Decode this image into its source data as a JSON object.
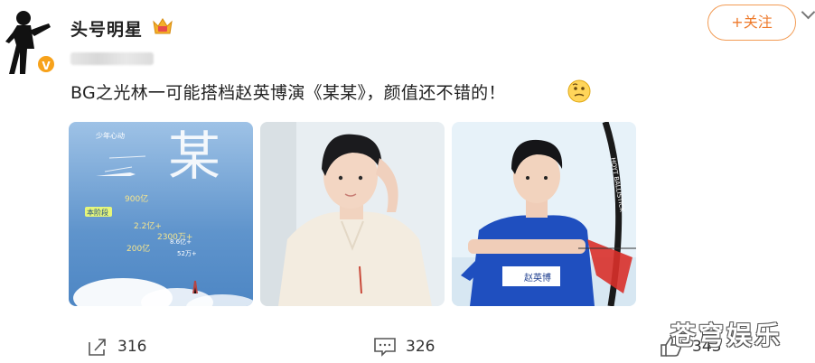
{
  "post": {
    "username": "头号明星",
    "text": "BG之光林一可能搭档赵英博演《某某》，颜值还不错的！",
    "follow_label": "+关注",
    "verified_mark": "V"
  },
  "images": [
    {
      "title_glyphs": "某",
      "poster_lines": [
        "少年心动",
        "900亿",
        "本阶段",
        "2.2亿+",
        "2300万+",
        "200亿",
        "8.6亿+",
        "52万+"
      ]
    },
    {
      "description": "portrait"
    },
    {
      "name_tag": "赵英博",
      "bow_text": "HOYT BALLISTICK"
    }
  ],
  "actions": {
    "repost_count": "316",
    "comment_count": "326",
    "like_count": "343"
  },
  "watermark": "苍穹娱乐",
  "colors": {
    "accent": "#ee7a2b",
    "verified": "#f7a21b",
    "sky": "#6f9fd0",
    "blue_shirt": "#1f4fbf"
  }
}
